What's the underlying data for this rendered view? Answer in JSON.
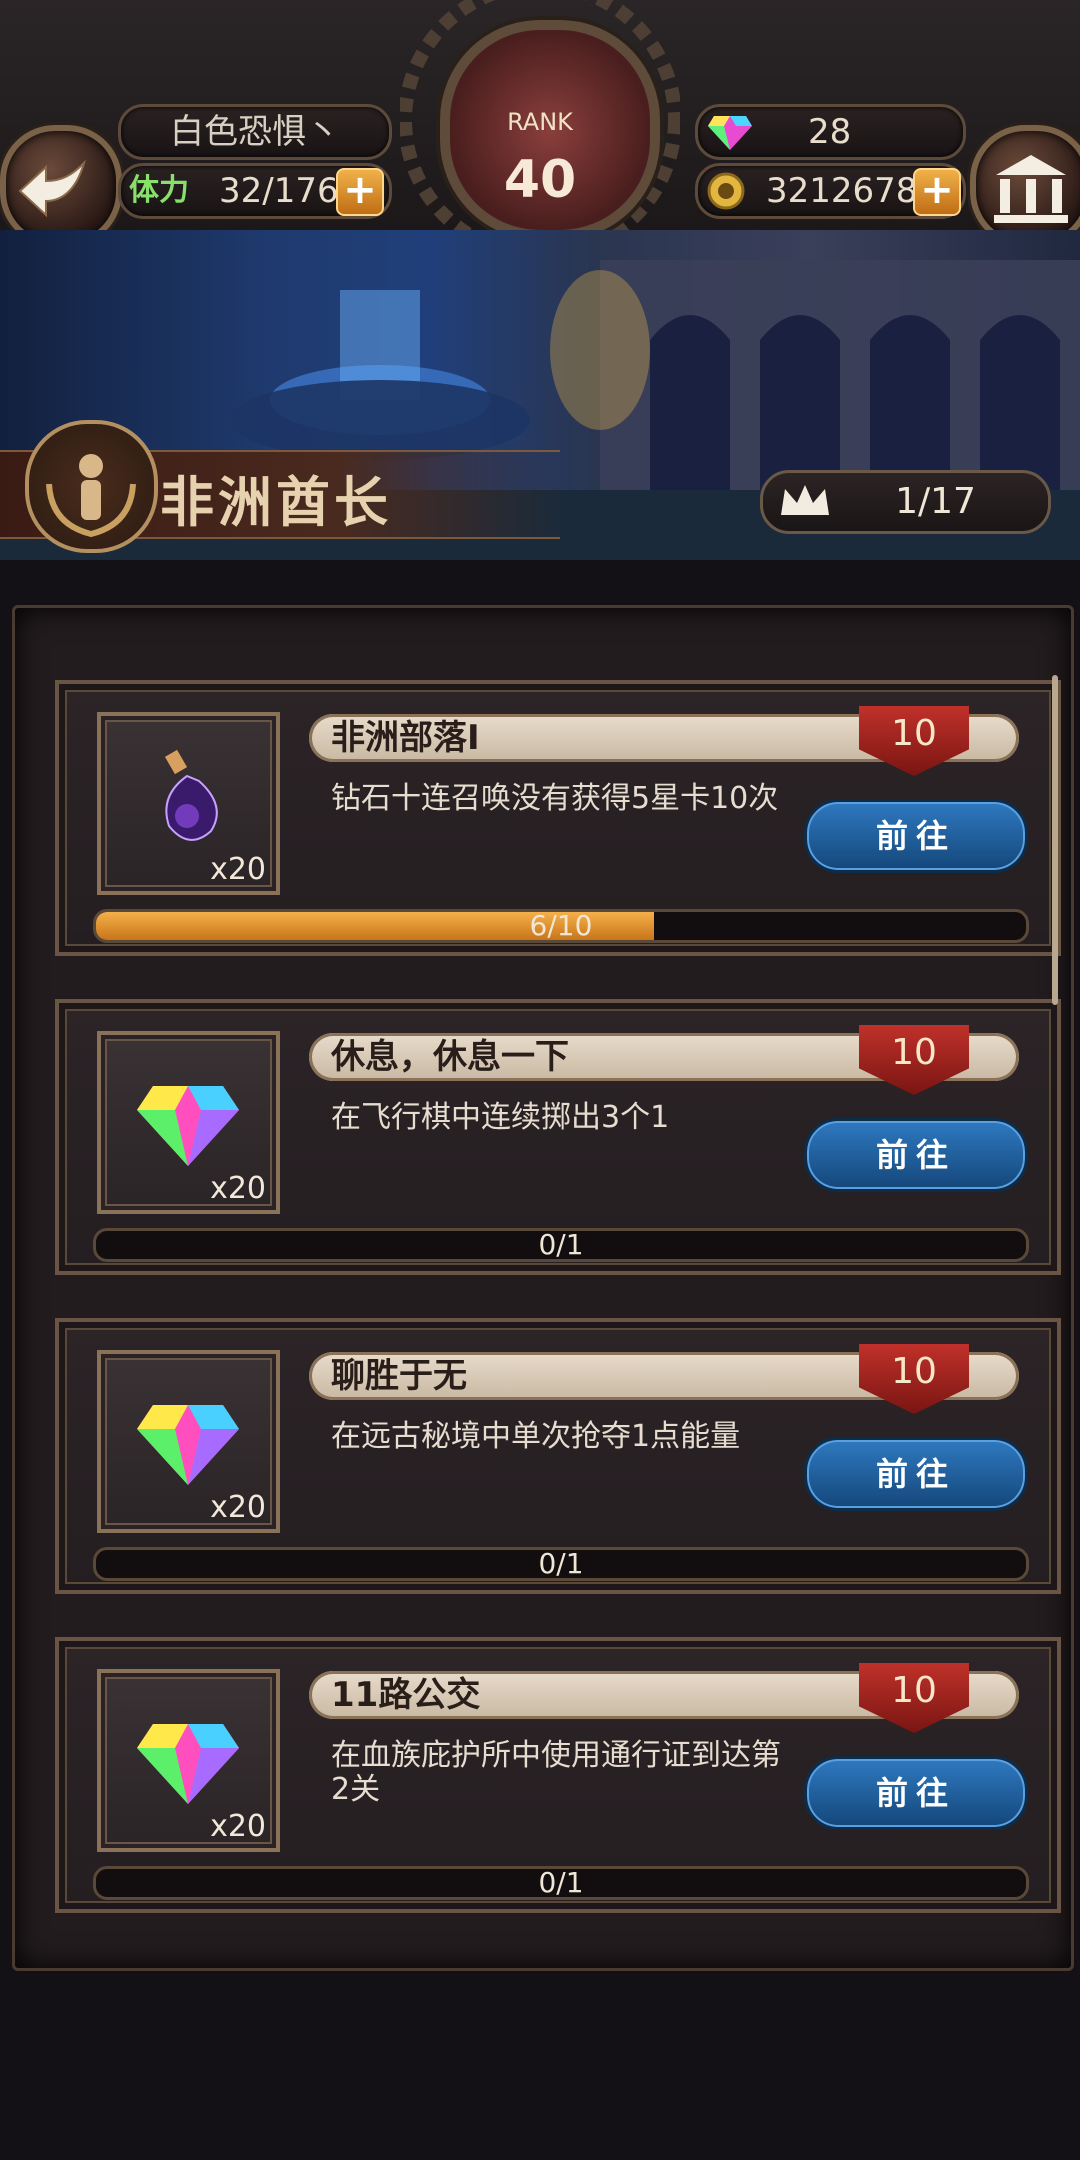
{
  "header": {
    "player_name": "白色恐惧丶",
    "stamina_label": "体力",
    "stamina_value": "32/176",
    "rank_label": "RANK",
    "rank_value": "40",
    "gems": "28",
    "gold": "3212678",
    "plus_symbol": "+"
  },
  "banner": {
    "title": "非洲酋长",
    "progress": "1/17"
  },
  "tasks": [
    {
      "name": "非洲部落Ⅰ",
      "reward_count": "10",
      "description": "钻石十连召唤没有获得5星卡10次",
      "item_qty": "x20",
      "item_icon": "potion-icon",
      "button": "前往",
      "progress_text": "6/10",
      "progress_fraction": 0.6
    },
    {
      "name": "休息，休息一下",
      "reward_count": "10",
      "description": "在飞行棋中连续掷出3个1",
      "item_qty": "x20",
      "item_icon": "rainbow-gem-icon",
      "button": "前往",
      "progress_text": "0/1",
      "progress_fraction": 0
    },
    {
      "name": "聊胜于无",
      "reward_count": "10",
      "description": "在远古秘境中单次抢夺1点能量",
      "item_qty": "x20",
      "item_icon": "rainbow-gem-icon",
      "button": "前往",
      "progress_text": "0/1",
      "progress_fraction": 0
    },
    {
      "name": "11路公交",
      "reward_count": "10",
      "description": "在血族庇护所中使用通行证到达第2关",
      "item_qty": "x20",
      "item_icon": "rainbow-gem-icon",
      "button": "前往",
      "progress_text": "0/1",
      "progress_fraction": 0
    }
  ]
}
